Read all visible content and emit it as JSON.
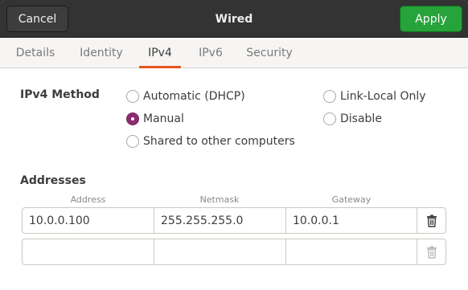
{
  "header": {
    "title": "Wired",
    "cancel_label": "Cancel",
    "apply_label": "Apply",
    "apply_color": "#26a33a"
  },
  "tabs": [
    {
      "label": "Details",
      "active": false
    },
    {
      "label": "Identity",
      "active": false
    },
    {
      "label": "IPv4",
      "active": true
    },
    {
      "label": "IPv6",
      "active": false
    },
    {
      "label": "Security",
      "active": false
    }
  ],
  "accent_color": "#e95420",
  "radio_color": "#8d2b6e",
  "ipv4_method": {
    "label": "IPv4 Method",
    "options": [
      {
        "label": "Automatic (DHCP)",
        "checked": false
      },
      {
        "label": "Manual",
        "checked": true
      },
      {
        "label": "Shared to other computers",
        "checked": false
      },
      {
        "label": "Link-Local Only",
        "checked": false
      },
      {
        "label": "Disable",
        "checked": false
      }
    ]
  },
  "addresses": {
    "label": "Addresses",
    "columns": [
      "Address",
      "Netmask",
      "Gateway"
    ],
    "rows": [
      {
        "address": "10.0.0.100",
        "netmask": "255.255.255.0",
        "gateway": "10.0.0.1",
        "delete_icon": "trash-icon"
      },
      {
        "address": "",
        "netmask": "",
        "gateway": "",
        "delete_icon": "trash-icon"
      }
    ]
  }
}
